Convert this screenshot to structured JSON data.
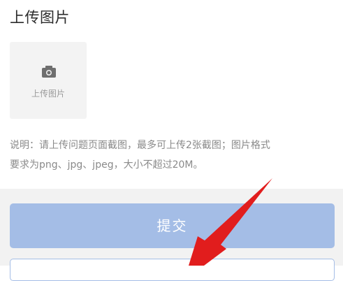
{
  "section": {
    "title": "上传图片"
  },
  "upload": {
    "label": "上传图片",
    "icon": "camera-icon"
  },
  "description": {
    "line1": "说明：请上传问题页面截图，最多可上传2张截图；图片格式",
    "line2": "要求为png、jpg、jpeg，大小不超过20M。"
  },
  "actions": {
    "submit_label": "提交"
  },
  "annotation": {
    "icon": "red-arrow-icon",
    "color": "#e11d1d"
  },
  "colors": {
    "submit_bg": "#a4bde6",
    "band_bg": "#f2f2f2"
  }
}
